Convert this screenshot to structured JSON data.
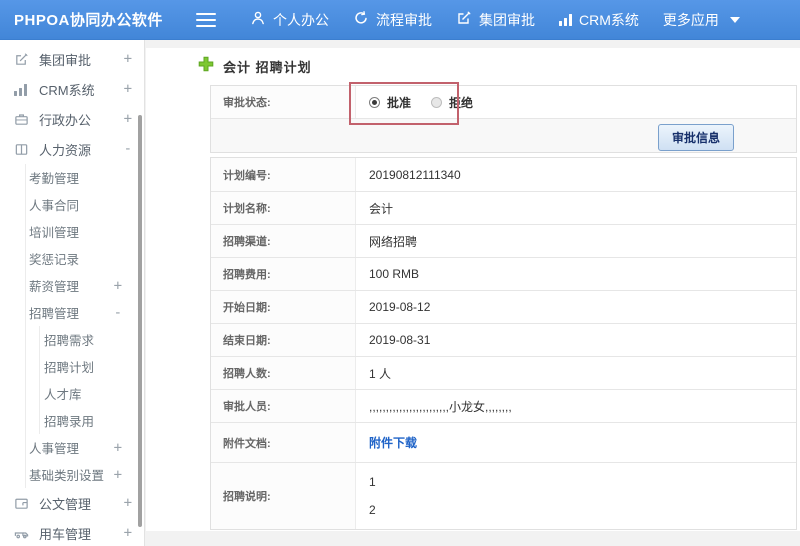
{
  "topbar": {
    "logo": "PHPOA协同办公软件",
    "nav": [
      {
        "label": "个人办公",
        "icon": "user-icon"
      },
      {
        "label": "流程审批",
        "icon": "process-icon"
      },
      {
        "label": "集团审批",
        "icon": "edit-icon"
      },
      {
        "label": "CRM系统",
        "icon": "bar-chart-icon"
      },
      {
        "label": "更多应用",
        "icon": "caret-down-icon"
      }
    ]
  },
  "sidebar": {
    "groups": [
      {
        "label": "集团审批",
        "toggle": "+"
      },
      {
        "label": "CRM系统",
        "toggle": "+"
      },
      {
        "label": "行政办公",
        "toggle": "+"
      },
      {
        "label": "人力资源",
        "toggle": "-",
        "children": [
          {
            "label": "考勤管理"
          },
          {
            "label": "人事合同"
          },
          {
            "label": "培训管理"
          },
          {
            "label": "奖惩记录"
          },
          {
            "label": "薪资管理",
            "toggle": "+"
          },
          {
            "label": "招聘管理",
            "toggle": "-",
            "children": [
              {
                "label": "招聘需求"
              },
              {
                "label": "招聘计划"
              },
              {
                "label": "人才库"
              },
              {
                "label": "招聘录用"
              }
            ]
          },
          {
            "label": "人事管理",
            "toggle": "+"
          },
          {
            "label": "基础类别设置",
            "toggle": "+"
          }
        ]
      },
      {
        "label": "公文管理",
        "toggle": "+"
      },
      {
        "label": "用车管理",
        "toggle": "+"
      }
    ]
  },
  "main": {
    "title": "会计 招聘计划",
    "approval": {
      "label": "审批状态:",
      "options": [
        {
          "label": "批准",
          "selected": true
        },
        {
          "label": "拒绝",
          "selected": false
        }
      ],
      "button_label": "审批信息"
    },
    "fields": [
      {
        "label": "计划编号:",
        "value": "20190812111340"
      },
      {
        "label": "计划名称:",
        "value": "会计"
      },
      {
        "label": "招聘渠道:",
        "value": "网络招聘"
      },
      {
        "label": "招聘费用:",
        "value": "100 RMB"
      },
      {
        "label": "开始日期:",
        "value": "2019-08-12"
      },
      {
        "label": "结束日期:",
        "value": "2019-08-31"
      },
      {
        "label": "招聘人数:",
        "value": "1 人"
      },
      {
        "label": "审批人员:",
        "value": ",,,,,,,,,,,,,,,,,,,,,,,,小龙女,,,,,,,,"
      },
      {
        "label": "附件文档:",
        "value": "附件下载"
      },
      {
        "label": "招聘说明:",
        "lines": [
          "1",
          "2"
        ]
      }
    ]
  },
  "colors": {
    "topbar_blue": "#4a8edc",
    "annotation_box_red": "#c2616c",
    "link_blue": "#2064c8",
    "plus_green": "#7dc832",
    "button_face": "#d9e7f7"
  }
}
